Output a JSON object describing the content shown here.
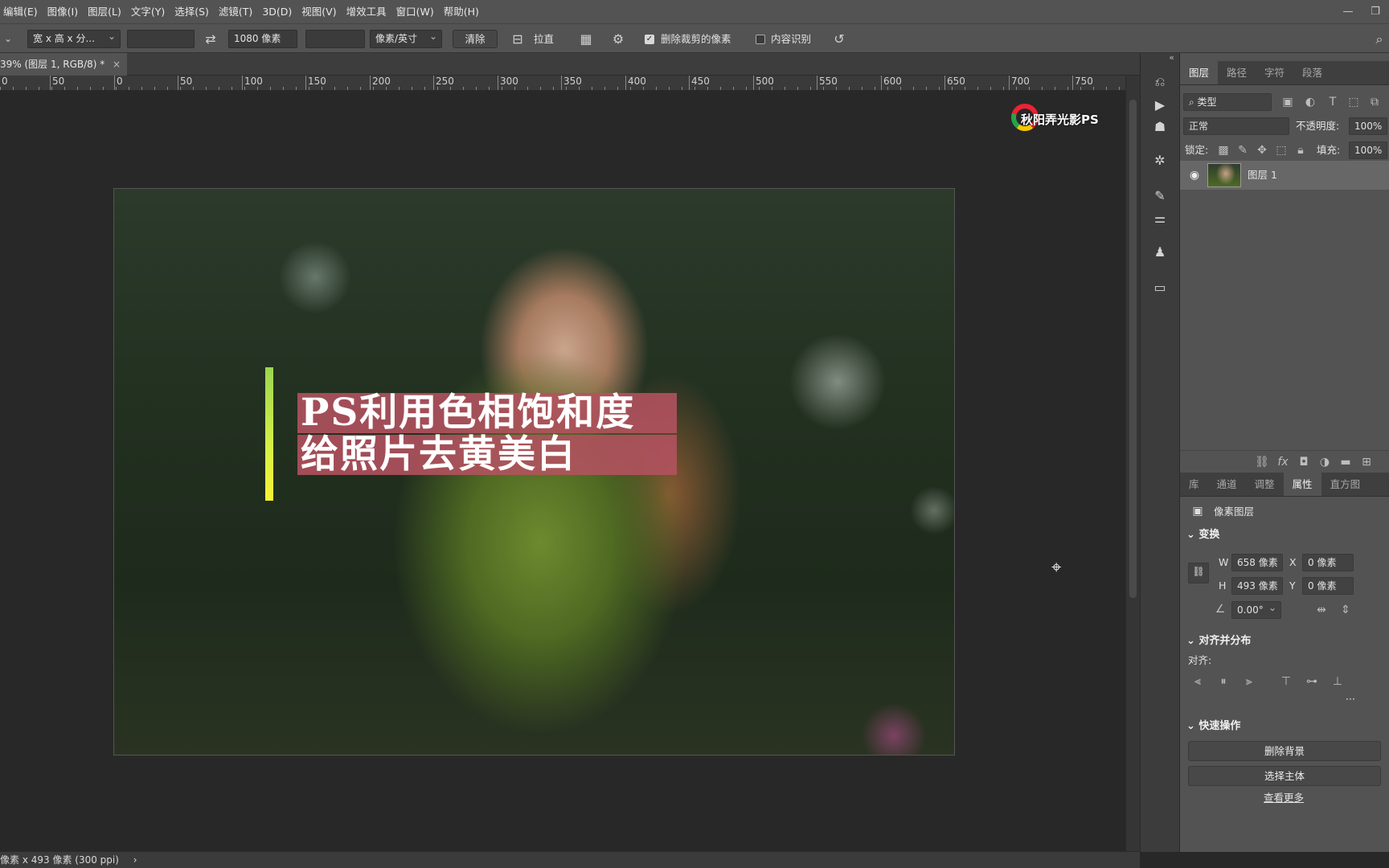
{
  "menubar": {
    "items": [
      "编辑(E)",
      "图像(I)",
      "图层(L)",
      "文字(Y)",
      "选择(S)",
      "滤镜(T)",
      "3D(D)",
      "视图(V)",
      "增效工具",
      "窗口(W)",
      "帮助(H)"
    ],
    "minimize": "—",
    "restore": "❐"
  },
  "options": {
    "ratio_preset": "宽 x 高 x 分...",
    "width_value": "",
    "swap_icon": "swap-icon",
    "height_value": "1080 像素",
    "resolution_value": "",
    "resolution_unit": "像素/英寸",
    "clear_label": "清除",
    "straighten_label": "拉直",
    "delete_cropped_label": "删除裁剪的像素",
    "delete_cropped_checked": true,
    "content_aware_label": "内容识别",
    "content_aware_checked": false
  },
  "document": {
    "tab_title": "39% (图层 1, RGB/8) *",
    "close": "×"
  },
  "ruler": {
    "labels": [
      "0",
      "50",
      "0",
      "50",
      "100",
      "150",
      "200",
      "250",
      "300",
      "350",
      "400",
      "450",
      "500",
      "550",
      "600",
      "650",
      "700",
      "750"
    ]
  },
  "canvas": {
    "logo_text": "秋阳弄光影PS",
    "title_line1": "PS利用色相饱和度",
    "title_line2": "给照片去黄美白"
  },
  "layers_panel": {
    "tabs": [
      "图层",
      "路径",
      "字符",
      "段落"
    ],
    "active_tab": "图层",
    "filter_kind": "类型",
    "blend_mode": "正常",
    "opacity_label": "不透明度:",
    "opacity_value": "100%",
    "lock_label": "锁定:",
    "fill_label": "填充:",
    "fill_value": "100%",
    "layers": [
      {
        "name": "图层 1",
        "visible": true
      }
    ]
  },
  "properties_panel": {
    "tabs": [
      "库",
      "通道",
      "调整",
      "属性",
      "直方图"
    ],
    "active_tab": "属性",
    "layer_type": "像素图层",
    "transform_title": "变换",
    "w_label": "W",
    "w_value": "658 像素",
    "h_label": "H",
    "h_value": "493 像素",
    "x_label": "X",
    "x_value": "0 像素",
    "y_label": "Y",
    "y_value": "0 像素",
    "angle_value": "0.00°",
    "align_title": "对齐并分布",
    "align_label": "对齐:",
    "more": "···",
    "quick_title": "快速操作",
    "remove_bg": "删除背景",
    "select_subject": "选择主体",
    "see_more": "查看更多"
  },
  "status": {
    "text": "像素 x 493 像素 (300 ppi)",
    "arrow": "›"
  }
}
